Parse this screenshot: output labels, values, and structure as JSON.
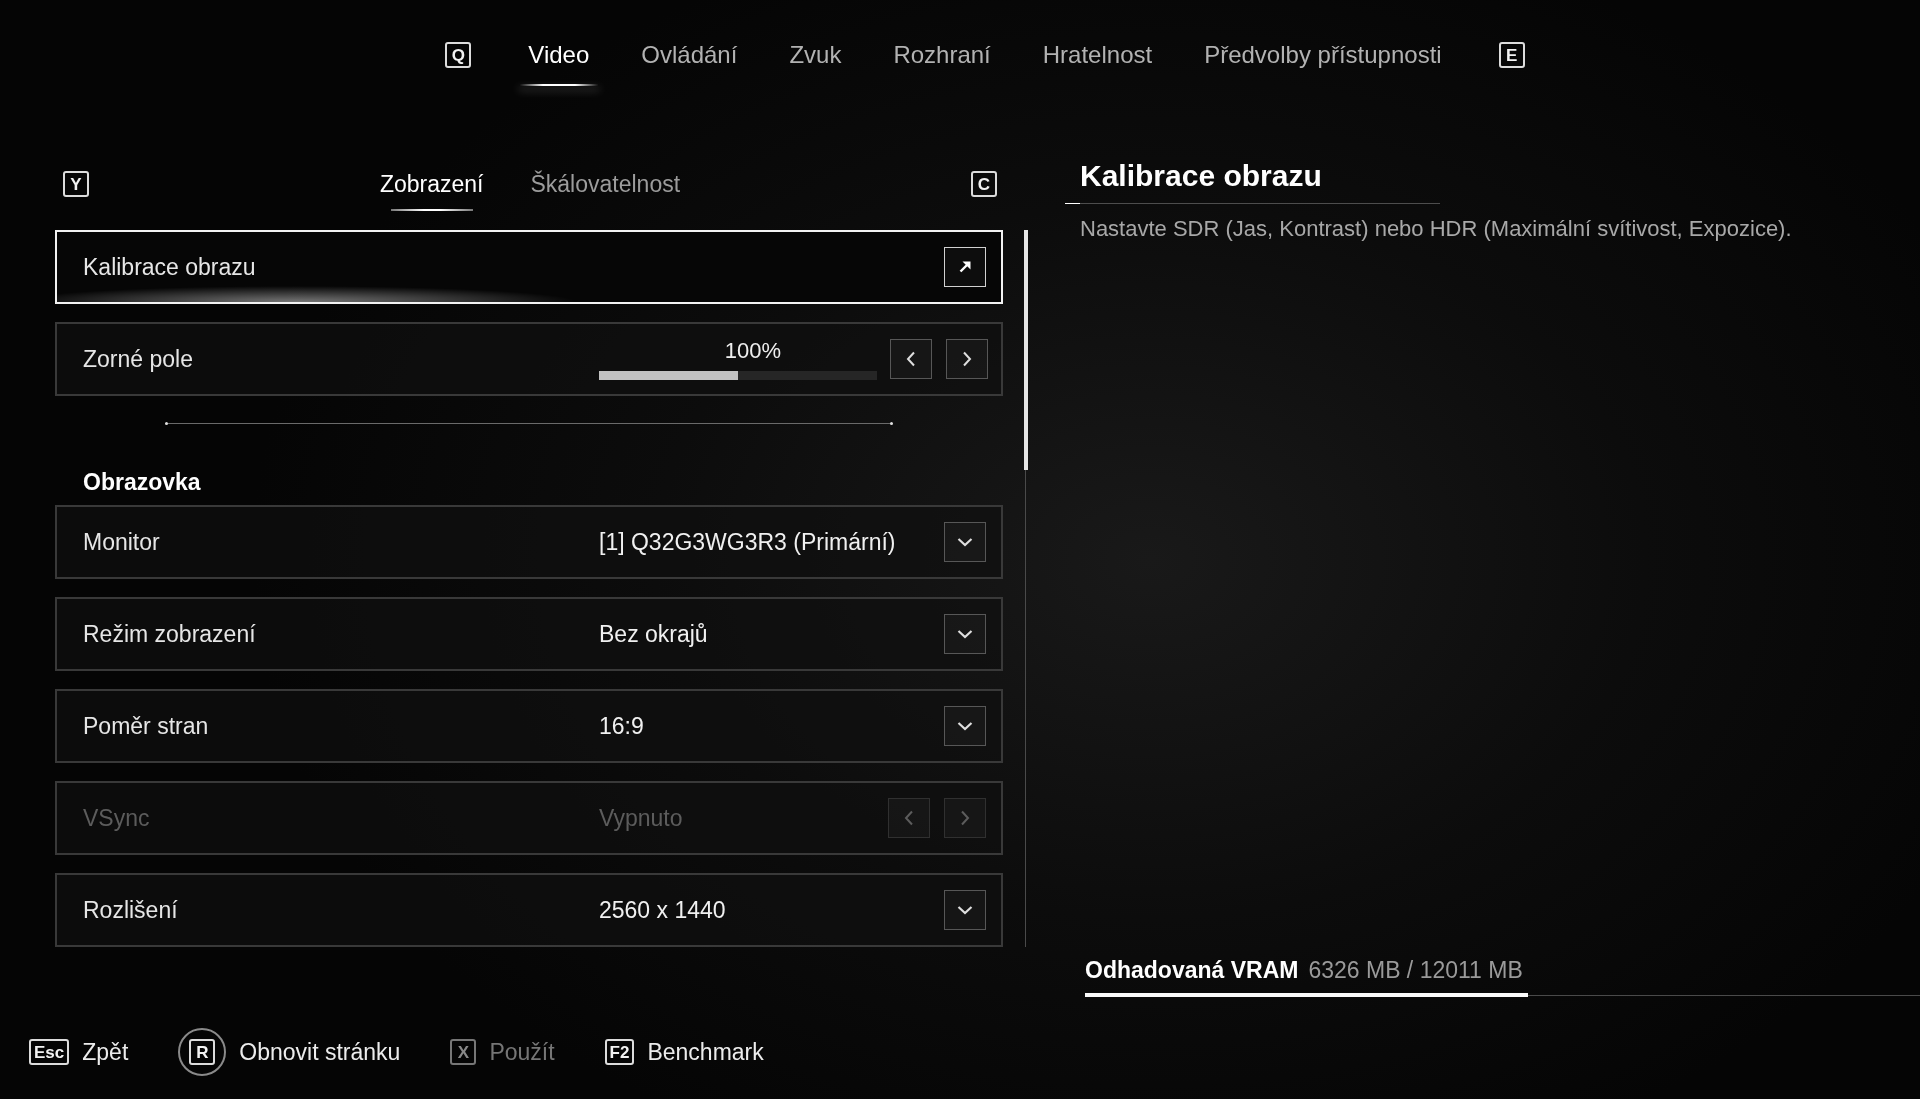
{
  "top_nav": {
    "prev_key": "Q",
    "next_key": "E",
    "tabs": [
      {
        "label": "Video",
        "selected": true
      },
      {
        "label": "Ovládání",
        "selected": false
      },
      {
        "label": "Zvuk",
        "selected": false
      },
      {
        "label": "Rozhraní",
        "selected": false
      },
      {
        "label": "Hratelnost",
        "selected": false
      },
      {
        "label": "Předvolby přístupnosti",
        "selected": false
      }
    ]
  },
  "settings_panel": {
    "prev_key": "Y",
    "next_key": "C",
    "tabs": [
      {
        "label": "Zobrazení",
        "selected": true
      },
      {
        "label": "Škálovatelnost",
        "selected": false
      }
    ],
    "sections": [
      {
        "rows": [
          {
            "kind": "link",
            "label": "Kalibrace obrazu",
            "selected": true,
            "disabled": false
          },
          {
            "kind": "slider",
            "label": "Zorné pole",
            "value": "100%",
            "level": 0.5,
            "selected": false,
            "disabled": false
          }
        ]
      },
      {
        "heading": "Obrazovka",
        "rows": [
          {
            "kind": "dropdown",
            "label": "Monitor",
            "value": "[1] Q32G3WG3R3 (Primární)",
            "selected": false,
            "disabled": false
          },
          {
            "kind": "dropdown",
            "label": "Režim zobrazení",
            "value": "Bez okrajů",
            "selected": false,
            "disabled": false
          },
          {
            "kind": "dropdown",
            "label": "Poměr stran",
            "value": "16:9",
            "selected": false,
            "disabled": false
          },
          {
            "kind": "stepper",
            "label": "VSync",
            "value": "Vypnuto",
            "selected": false,
            "disabled": true
          },
          {
            "kind": "dropdown",
            "label": "Rozlišení",
            "value": "2560 x 1440",
            "selected": false,
            "disabled": false
          }
        ]
      }
    ]
  },
  "detail_panel": {
    "title": "Kalibrace obrazu",
    "description": "Nastavte SDR (Jas, Kontrast) nebo HDR (Maximální svítivost, Expozice)."
  },
  "vram": {
    "label": "Odhadovaná VRAM",
    "reading": "6326 MB / 12011 MB",
    "level": 0.53
  },
  "footer_actions": [
    {
      "kind": "key",
      "key": "Esc",
      "label": "Zpět",
      "disabled": false
    },
    {
      "kind": "hold",
      "key": "R",
      "label": "Obnovit stránku",
      "disabled": false
    },
    {
      "kind": "key",
      "key": "X",
      "label": "Použít",
      "disabled": true
    },
    {
      "kind": "key",
      "key": "F2",
      "label": "Benchmark",
      "disabled": false
    }
  ]
}
